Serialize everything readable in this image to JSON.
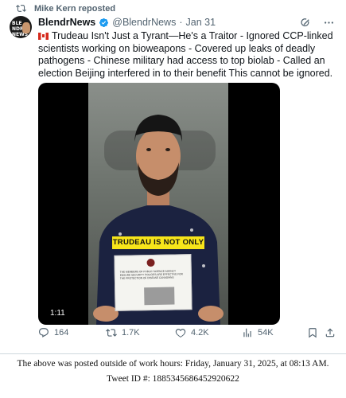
{
  "repost": {
    "label": "Mike Kern reposted",
    "icon": "repost-icon"
  },
  "author": {
    "name": "BlendrNews",
    "handle": "@BlendrNews",
    "separator": "·",
    "date": "Jan 31",
    "avatar_text": "BLE NDR NEWS"
  },
  "tweet": {
    "text": "Trudeau Isn't Just a Tyrant—He's a Traitor - Ignored CCP-linked scientists working on bioweapons - Covered up leaks of deadly pathogens - Chinese military had access to top biolab - Called an election Beijing interfered in to their benefit This cannot be ignored."
  },
  "video": {
    "caption": "TRUDEAU IS NOT ONLY",
    "duration": "1:11",
    "doc_text": "THE MEMBERS OF PUBLIC SCIENCE AGENCY ENSURE SECURITY POLICIES ARE EFFECTIVE FOR THE PROTECTION OF DISEASE CANADIANS"
  },
  "actions": {
    "replies": "164",
    "reposts": "1.7K",
    "likes": "4.2K",
    "views": "54K"
  },
  "footer": {
    "line1": "The above was posted outside of work hours: Friday, January 31, 2025, at 08:13 AM.",
    "line2": "Tweet ID #: 1885345686452920622"
  },
  "colors": {
    "verified": "#1d9bf0",
    "secondary": "#536471",
    "caption_bg": "#f7e51a"
  }
}
